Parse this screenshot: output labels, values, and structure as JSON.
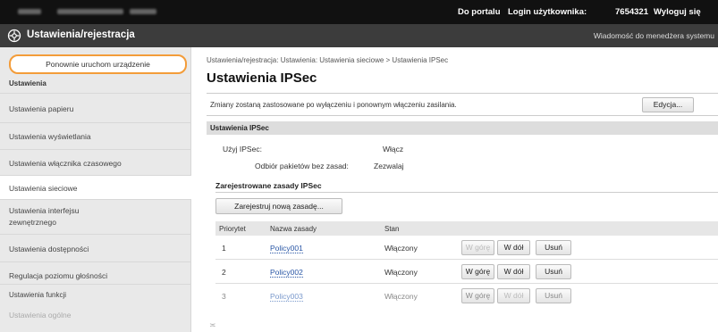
{
  "topbar": {
    "portal_link": "Do portalu",
    "login_label": "Login użytkownika:",
    "login_id": "7654321",
    "logout": "Wyloguj się"
  },
  "header": {
    "title": "Ustawienia/rejestracja",
    "manager_message": "Wiadomość do menedżera systemu"
  },
  "sidebar": {
    "restart_button": "Ponownie uruchom urządzenie",
    "section_settings": "Ustawienia",
    "items": [
      {
        "label": "Ustawienia papieru"
      },
      {
        "label": "Ustawienia wyświetlania"
      },
      {
        "label": "Ustawienia włącznika czasowego"
      },
      {
        "label": "Ustawienia sieciowe"
      },
      {
        "label": "Ustawienia interfejsu zewnętrznego"
      },
      {
        "label": "Ustawienia dostępności"
      },
      {
        "label": "Regulacja poziomu głośności"
      }
    ],
    "section_functions": "Ustawienia funkcji",
    "faded_item": "Ustawienia ogólne"
  },
  "main": {
    "breadcrumb": "Ustawienia/rejestracja: Ustawienia: Ustawienia sieciowe > Ustawienia IPSec",
    "page_title": "Ustawienia IPSec",
    "notice": "Zmiany zostaną zastosowane po wyłączeniu i ponownym włączeniu zasilania.",
    "edit_button": "Edycja...",
    "section_title": "Ustawienia IPSec",
    "use_ipsec_label": "Użyj IPSec:",
    "use_ipsec_value": "Włącz",
    "receive_label": "Odbiór pakietów bez zasad:",
    "receive_value": "Zezwalaj",
    "registered_title": "Zarejestrowane zasady IPSec",
    "register_button": "Zarejestruj nową zasadę...",
    "columns": {
      "priority": "Priorytet",
      "name": "Nazwa zasady",
      "status": "Stan"
    },
    "rows": [
      {
        "priority": "1",
        "name": "Policy001",
        "status": "Włączony",
        "up": "W górę",
        "down": "W dół",
        "delete": "Usuń"
      },
      {
        "priority": "2",
        "name": "Policy002",
        "status": "Włączony",
        "up": "W górę",
        "down": "W dół",
        "delete": "Usuń"
      },
      {
        "priority": "3",
        "name": "Policy003",
        "status": "Włączony",
        "up": "W górę",
        "down": "W dół",
        "delete": "Usuń"
      }
    ],
    "more_marker": "≍"
  },
  "colors": {
    "topbar": "#111111",
    "titlebar": "#3c3c3c",
    "highlight": "#f39c39",
    "link": "#2a57a6"
  }
}
